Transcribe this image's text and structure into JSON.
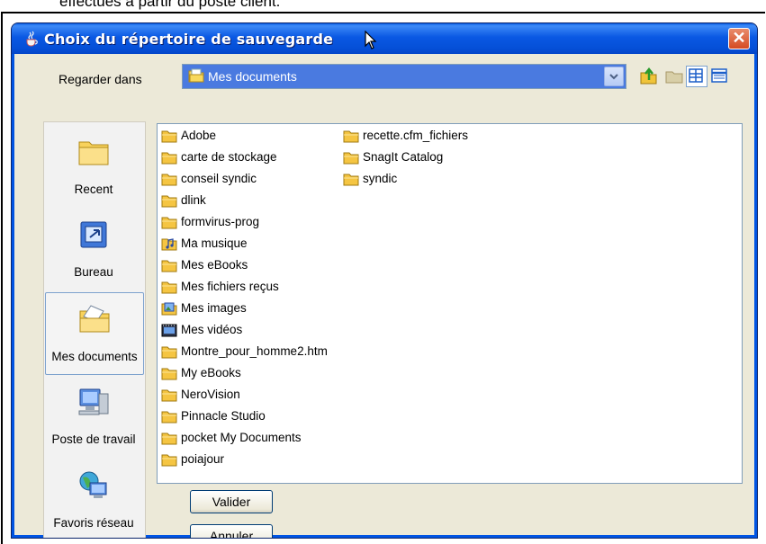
{
  "doc_caption": "effectués à partir du poste client.",
  "dialog": {
    "title": "Choix du répertoire de sauvegarde",
    "close_glyph": "✕"
  },
  "look_in": {
    "label": "Regarder dans",
    "selected": "Mes documents"
  },
  "places": [
    {
      "label": "Recent",
      "icon": "recent-folder-icon"
    },
    {
      "label": "Bureau",
      "icon": "desktop-icon"
    },
    {
      "label": "Mes documents",
      "icon": "my-documents-icon",
      "selected": true
    },
    {
      "label": "Poste de travail",
      "icon": "my-computer-icon"
    },
    {
      "label": "Favoris réseau",
      "icon": "network-icon"
    }
  ],
  "files_col1": [
    {
      "name": "Adobe",
      "icon": "folder-icon"
    },
    {
      "name": "carte de stockage",
      "icon": "folder-icon"
    },
    {
      "name": "conseil syndic",
      "icon": "folder-icon"
    },
    {
      "name": "dlink",
      "icon": "folder-icon"
    },
    {
      "name": "formvirus-prog",
      "icon": "folder-icon"
    },
    {
      "name": "Ma musique",
      "icon": "music-folder-icon"
    },
    {
      "name": "Mes eBooks",
      "icon": "folder-icon"
    },
    {
      "name": "Mes fichiers reçus",
      "icon": "folder-icon"
    },
    {
      "name": "Mes images",
      "icon": "pictures-folder-icon"
    },
    {
      "name": "Mes vidéos",
      "icon": "videos-folder-icon"
    },
    {
      "name": "Montre_pour_homme2.htm",
      "icon": "folder-icon"
    },
    {
      "name": "My eBooks",
      "icon": "folder-icon"
    },
    {
      "name": "NeroVision",
      "icon": "folder-icon"
    },
    {
      "name": "Pinnacle Studio",
      "icon": "folder-icon"
    },
    {
      "name": "pocket My Documents",
      "icon": "folder-icon"
    },
    {
      "name": "poiajour",
      "icon": "folder-icon"
    }
  ],
  "files_col2": [
    {
      "name": "recette.cfm_fichiers",
      "icon": "folder-icon"
    },
    {
      "name": "SnagIt Catalog",
      "icon": "folder-icon"
    },
    {
      "name": "syndic",
      "icon": "folder-icon"
    }
  ],
  "buttons": {
    "validate": "Valider",
    "cancel": "Annuler"
  },
  "colors": {
    "titlebar": "#0a58e3",
    "combo_selected": "#4a7ae0",
    "folder": "#f5c542"
  }
}
